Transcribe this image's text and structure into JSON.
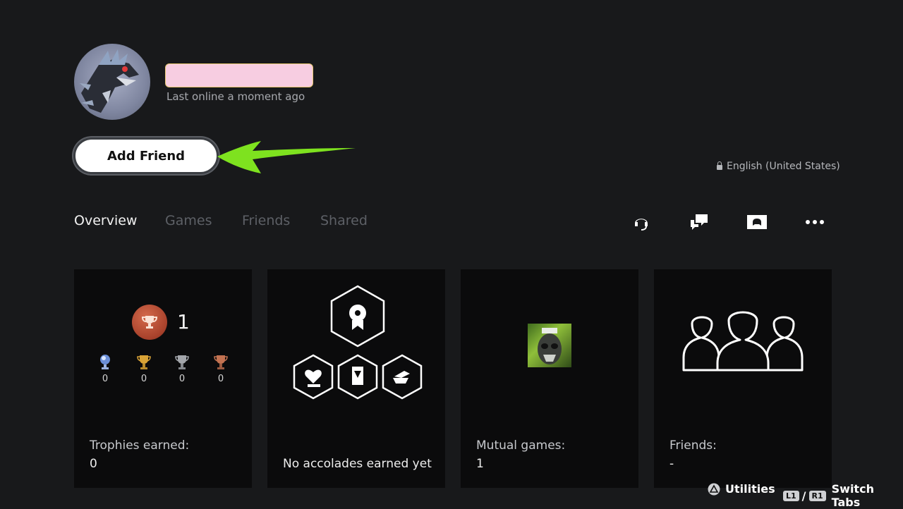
{
  "profile": {
    "last_online": "Last online a moment ago",
    "add_friend_label": "Add Friend",
    "language": "English (United States)"
  },
  "tabs": [
    {
      "label": "Overview",
      "active": true
    },
    {
      "label": "Games",
      "active": false
    },
    {
      "label": "Friends",
      "active": false
    },
    {
      "label": "Shared",
      "active": false
    }
  ],
  "actions": [
    {
      "icon": "headset-icon"
    },
    {
      "icon": "message-icon"
    },
    {
      "icon": "share-screen-icon"
    },
    {
      "icon": "more-options-icon"
    }
  ],
  "cards": {
    "trophies": {
      "level": "1",
      "platinum": "0",
      "gold": "0",
      "silver": "0",
      "bronze": "0",
      "label": "Trophies earned:",
      "value": "0"
    },
    "accolades": {
      "label": "No accolades earned yet"
    },
    "mutual_games": {
      "label": "Mutual games:",
      "value": "1"
    },
    "friends": {
      "label": "Friends:",
      "value": "-"
    }
  },
  "footer": {
    "utilities": "Utilities",
    "l1": "L1",
    "separator": "/",
    "r1": "R1",
    "switch_tabs": "Switch Tabs"
  },
  "colors": {
    "background": "#18191b",
    "card": "#0b0b0c",
    "name_highlight": "#f7cde1",
    "arrow": "#7ee21f",
    "trophy_level": "#a7412b"
  }
}
